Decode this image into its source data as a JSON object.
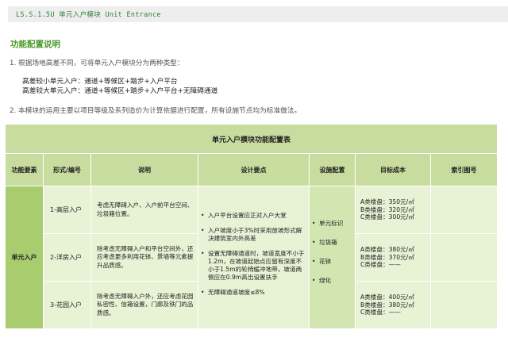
{
  "header": {
    "code_title": "LS.S.1.5U  单元入户模块  Unit Entrance"
  },
  "section_title": "功能配置说明",
  "para1": "1.  根据场地高差不同，可将单元入户模块分为两种类型：",
  "types": [
    "高差较小单元入户：通道+等候区+踏步+入户平台",
    "高差较大单元入户：通道+等候区+踏步+入户平台+无障碍通道"
  ],
  "para2": "2.  本模块的运用主要以项目等级及系列造价为计算依据进行配置，所有设施节点均为标准做法。",
  "table": {
    "title": "单元入户模块功能配置表",
    "headers": [
      "功能要素",
      "形式/编号",
      "说明",
      "设计要点",
      "设施配置",
      "目标成本",
      "索引图号"
    ],
    "unit": "单元入户",
    "rows": [
      {
        "type": "1-高层入户",
        "desc": "考虑无障碍入户、入户前平台空间、垃圾箱位置。",
        "cost": [
          "A类楼盘：350元/㎡",
          "B类楼盘：320元/㎡",
          "C类楼盘：300元/㎡"
        ],
        "index": ""
      },
      {
        "type": "2-洋房入户",
        "desc": "除考虑无障碍入户和平台空间外，还应考虑更多利用花钵、景墙等元素提升品质感。",
        "cost": [
          "A类楼盘：380元/㎡",
          "B类楼盘：370元/㎡",
          "C类楼盘：——"
        ],
        "index": ""
      },
      {
        "type": "3-花园入户",
        "desc": "除考虑无障碍入户外，还应考虑花园私密性、信箱设置，门廊及铁门的品质感。",
        "cost": [
          "A类楼盘：400元/㎡",
          "B类楼盘：380元/㎡",
          "C类楼盘：——"
        ],
        "index": ""
      }
    ],
    "design_points": [
      "入户平台设置应正对入户大堂",
      "入户坡度小于3%时采用放坡形式解决建筑室内外高差",
      "设置无障碍通道时，坡道宽度不小于1.2m，在坡道起始点应留有深度不小于1.5m的轮椅缓冲地带，坡道两侧应在0.9m高出设置扶手",
      "无障碍通道坡度≤8%"
    ],
    "facilities": [
      "单元标识",
      "垃圾箱",
      "花钵",
      "绿化"
    ]
  }
}
